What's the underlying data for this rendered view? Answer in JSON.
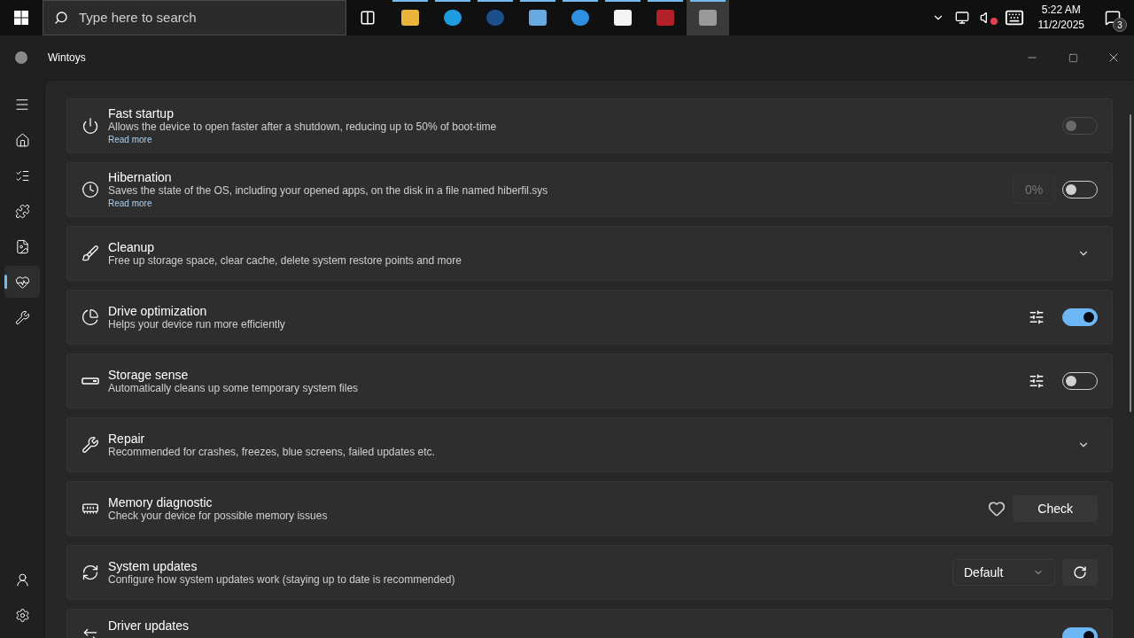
{
  "taskbar": {
    "search": {
      "placeholder": "Type here to search"
    },
    "apps": [
      {
        "running": true,
        "active": false
      },
      {
        "running": true,
        "active": false
      },
      {
        "running": true,
        "active": false
      },
      {
        "running": true,
        "active": false
      },
      {
        "running": true,
        "active": false
      },
      {
        "running": true,
        "active": false
      },
      {
        "running": true,
        "active": false
      },
      {
        "running": true,
        "active": true
      }
    ],
    "tray": {
      "time": "5:22 AM",
      "date": "11/2/2025",
      "notifications": "3"
    }
  },
  "window": {
    "title": "Wintoys"
  },
  "sidebar": {
    "items": [
      {
        "selected": false
      },
      {
        "selected": false
      },
      {
        "selected": false
      },
      {
        "selected": false
      },
      {
        "selected": true
      },
      {
        "selected": false
      }
    ],
    "bottom_items": [
      {
        "selected": false
      },
      {
        "selected": false
      }
    ]
  },
  "cards": [
    {
      "kind": "toggle",
      "title": "Fast startup",
      "description": "Allows the device to open faster after a shutdown, reducing up to 50% of boot-time",
      "link": "Read more",
      "on": false,
      "disabled": true
    },
    {
      "kind": "toggle",
      "title": "Hibernation",
      "description": "Saves the state of the OS, including your opened apps, on the disk in a file named hiberfil.sys",
      "link": "Read more",
      "field": "0%",
      "on": false,
      "disabled": false
    },
    {
      "kind": "expander",
      "title": "Cleanup",
      "description": "Free up storage space, clear cache, delete system restore points and more",
      "expanded": false
    },
    {
      "kind": "settings_toggle",
      "title": "Drive optimization",
      "description": "Helps your device run more efficiently",
      "on": true
    },
    {
      "kind": "settings_toggle",
      "title": "Storage sense",
      "description": "Automatically cleans up some temporary system files",
      "on": false,
      "disabled": false
    },
    {
      "kind": "expander",
      "title": "Repair",
      "description": "Recommended for crashes, freezes, blue screens, failed updates etc.",
      "expanded": false
    },
    {
      "kind": "button",
      "title": "Memory diagnostic",
      "description": "Check your device for possible memory issues",
      "button": "Check"
    },
    {
      "kind": "dropdown",
      "title": "System updates",
      "description": "Configure how system updates work (staying up to date is recommended)",
      "value": "Default"
    },
    {
      "kind": "toggle",
      "title": "Driver updates",
      "on": true
    }
  ]
}
